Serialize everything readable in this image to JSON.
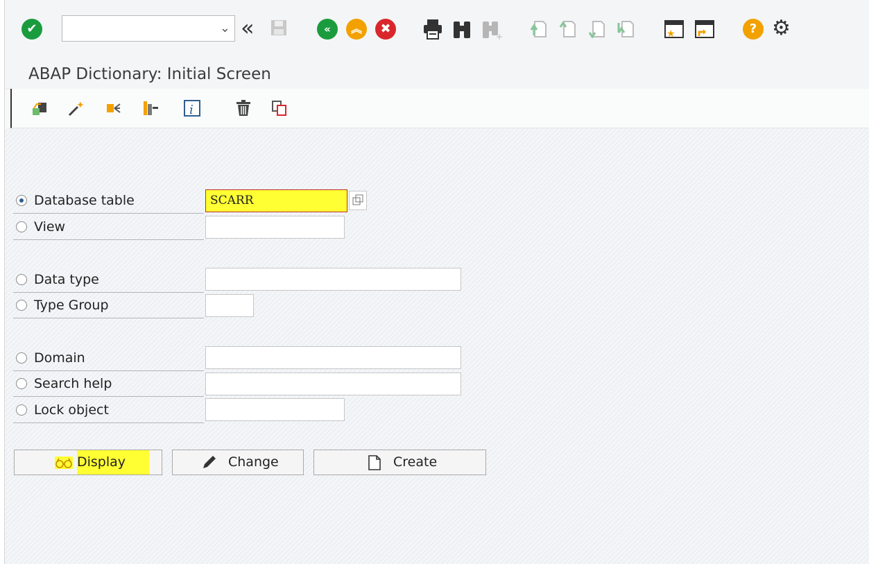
{
  "toolbar": {
    "command_field": {
      "value": "",
      "dropdown_icon": "chevron-down-icon"
    },
    "icons": [
      "enter-check-icon",
      "back-double-chevron-icon",
      "save-icon",
      "back-icon",
      "exit-icon",
      "cancel-icon",
      "print-icon",
      "find-icon",
      "find-next-icon",
      "first-page-icon",
      "previous-page-icon",
      "next-page-icon",
      "last-page-icon",
      "new-session-icon",
      "shortcut-icon",
      "help-icon",
      "settings-gear-icon"
    ]
  },
  "title": "ABAP Dictionary: Initial Screen",
  "app_toolbar": {
    "icons": [
      "other-object-icon",
      "wizard-icon",
      "where-used-icon",
      "object-list-icon",
      "info-icon",
      "delete-icon",
      "copy-icon"
    ]
  },
  "form": {
    "rows": [
      {
        "label": "Database table",
        "selected": true,
        "value": "SCARR"
      },
      {
        "label": "View",
        "selected": false,
        "value": ""
      },
      {
        "label": "Data type",
        "selected": false,
        "value": ""
      },
      {
        "label": "Type Group",
        "selected": false,
        "value": ""
      },
      {
        "label": "Domain",
        "selected": false,
        "value": ""
      },
      {
        "label": "Search help",
        "selected": false,
        "value": ""
      },
      {
        "label": "Lock object",
        "selected": false,
        "value": ""
      }
    ]
  },
  "buttons": {
    "display": "Display",
    "change": "Change",
    "create": "Create"
  },
  "colors": {
    "highlight": "#ffff33",
    "green": "#1a9c3e",
    "orange": "#f2a100",
    "red": "#d9262c"
  }
}
